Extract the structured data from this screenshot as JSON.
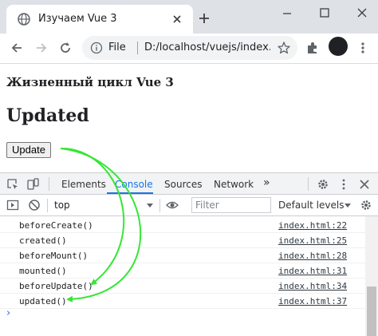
{
  "browser": {
    "tab_title": "Изучаем Vue 3",
    "omnibox": {
      "scheme_label": "File",
      "url": "D:/localhost/vuejs/index.h..."
    },
    "avatar_color": "#202124"
  },
  "page": {
    "heading": "Жизненный цикл Vue 3",
    "status": "Updated",
    "button_label": "Update"
  },
  "devtools": {
    "tabs": [
      {
        "label": "Elements",
        "active": false
      },
      {
        "label": "Console",
        "active": true
      },
      {
        "label": "Sources",
        "active": false
      },
      {
        "label": "Network",
        "active": false
      }
    ],
    "more_tabs": "»",
    "context": "top",
    "filter_placeholder": "Filter",
    "levels": "Default levels",
    "logs": [
      {
        "message": "beforeCreate()",
        "source": "index.html:22"
      },
      {
        "message": "created()",
        "source": "index.html:25"
      },
      {
        "message": "beforeMount()",
        "source": "index.html:28"
      },
      {
        "message": "mounted()",
        "source": "index.html:31"
      },
      {
        "message": "beforeUpdate()",
        "source": "index.html:34"
      },
      {
        "message": "updated()",
        "source": "index.html:37"
      }
    ],
    "prompt_symbol": "›",
    "accent_color": "#1a73e8"
  },
  "annotation": {
    "arrow_color": "#33e833"
  }
}
